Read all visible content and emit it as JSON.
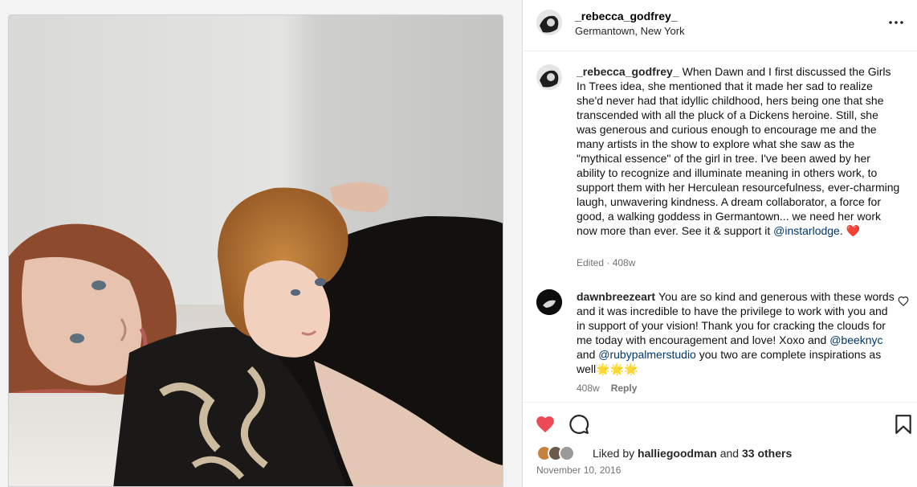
{
  "post": {
    "username": "_rebecca_godfrey_",
    "location": "Germantown, New York",
    "more_icon": "more-horizontal-icon"
  },
  "caption": {
    "username": "_rebecca_godfrey_",
    "text": "When Dawn and I first discussed the Girls In Trees idea, she mentioned that it made her sad to realize she'd never had that idyllic childhood, hers being one that she transcended with all the pluck of a Dickens heroine. Still, she was generous and curious enough to encourage me and the many artists in the show to explore what she saw as the \"mythical essence\" of the girl in tree. I've been awed by her ability to recognize and illuminate meaning in others work, to support them with her Herculean resourcefulness, ever-charming laugh, unwavering kindness. A dream collaborator, a force for good, a walking goddess in Germantown... we need her work now more than ever. See it & support it",
    "mention": "@instarlodge",
    "after_mention": ".",
    "emoji": "❤️",
    "meta": "Edited · 408w"
  },
  "reply": {
    "username": "dawnbreezeart",
    "text_1": "You are so kind and generous with these words and it was incredible to have the privilege to work with you and in support of your vision! Thank you for cracking the clouds for me today with encouragement and love! Xoxo and",
    "mention_1": "@beeknyc",
    "text_2": "and",
    "mention_2": "@rubypalmerstudio",
    "text_3": "you two are complete inspirations as well",
    "emoji": "🌟🌟🌟",
    "time": "408w",
    "reply_label": "Reply"
  },
  "actions": {
    "like_icon": "heart-filled-icon",
    "comment_icon": "comment-icon",
    "save_icon": "bookmark-icon",
    "like_color": "#ed4956"
  },
  "likes": {
    "prefix": "Liked by",
    "user": "halliegoodman",
    "joiner": "and",
    "others": "33 others"
  },
  "date": "November 10, 2016"
}
